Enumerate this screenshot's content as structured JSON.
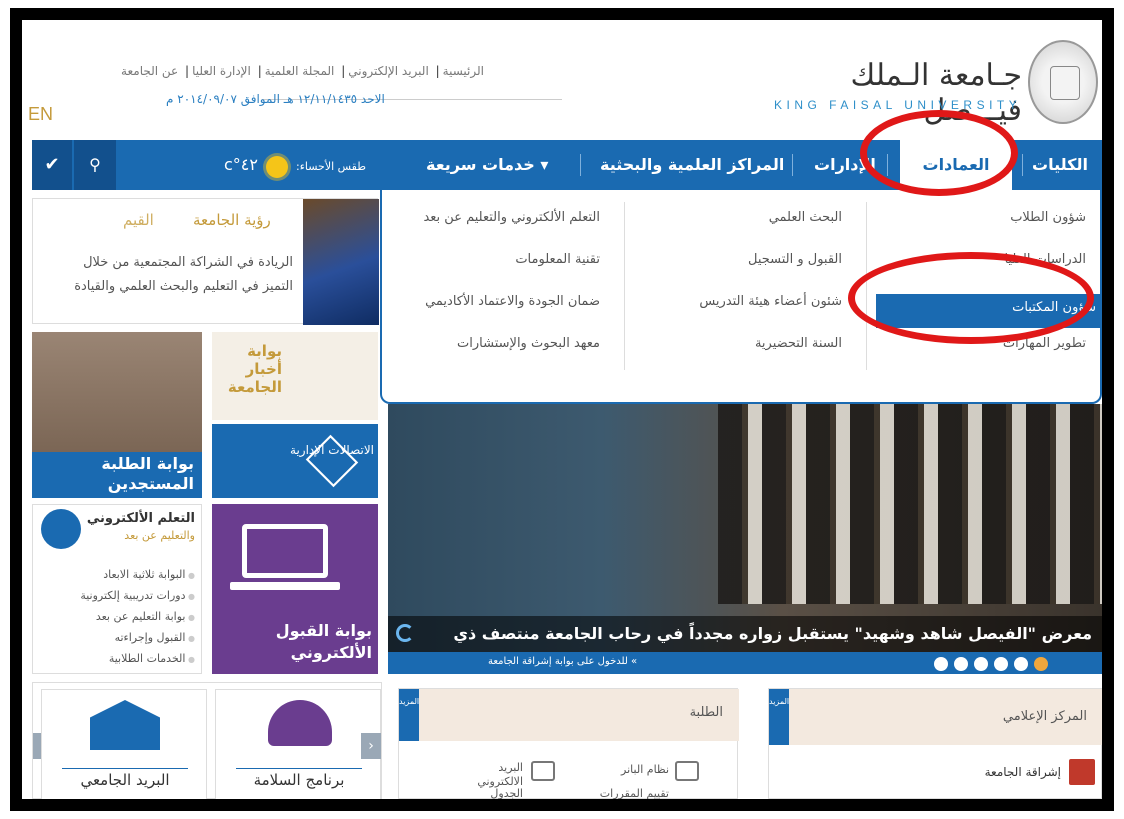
{
  "header": {
    "lang_switch": "EN",
    "top_links": [
      "الرئيسية",
      "البريد الإلكتروني",
      "المجلة العلمية",
      "الإدارة العليا",
      "عن الجامعة"
    ],
    "date_hijri": "الاحد ١٢/١١/١٤٣٥ هـ",
    "date_gregorian": "الموافق ٢٠١٤/٠٩/٠٧ م",
    "logo_arabic": "جـامعة الـملك فيـــصل",
    "logo_english": "KING FAISAL UNIVERSITY"
  },
  "nav": {
    "items": [
      "الكليات",
      "العمادات",
      "الإدارات",
      "المراكز العلمية والبحثية",
      "خدمات سريعة"
    ],
    "active": "العمادات",
    "weather_label": "طقس الأحساء:",
    "weather_temp": "٤٢°c",
    "search_icon": "search-icon",
    "check_icon": "check-icon"
  },
  "dropdown": {
    "col_right": [
      "شؤون الطلاب",
      "الدراسات العليا",
      "شؤون المكتبات",
      "تطوير المهارات"
    ],
    "col_middle": [
      "البحث العلمي",
      "القبول و التسجيل",
      "شئون أعضاء هيئة التدريس",
      "السنة التحضيرية"
    ],
    "col_left": [
      "التعلم الألكتروني والتعليم عن بعد",
      "تقنية المعلومات",
      "ضمان الجودة والاعتماد الأكاديمي",
      "معهد البحوث والإستشارات"
    ],
    "highlighted": "شؤون المكتبات"
  },
  "vision": {
    "tab_vision": "رؤية الجامعة",
    "tab_values": "القيم",
    "text": "الريادة في الشراكة المجتمعية من خلال التميز في التعليم والبحث العلمي والقيادة"
  },
  "tiles": {
    "students_portal": "بوابة الطلبة المستجدين",
    "news_portal": "بوابة أخبار الجامعة",
    "admin_comm": "الاتصالات الإدارية",
    "admission_portal": "بوابة القبول الألكتروني"
  },
  "elearning": {
    "title": "التعلم الألكتروني",
    "subtitle": "والتعليم عن بعد",
    "links": [
      "البوابة ثلاثية الابعاد",
      "دورات تدريبية إلكترونية",
      "بوابة التعليم عن بعد",
      "القبول وإجراءته",
      "الخدمات الطلابية"
    ]
  },
  "slider": {
    "caption": "معرض \"الفيصل شاهد وشهيد\" يستقبل زواره مجدداً في رحاب الجامعة منتصف ذي",
    "link": "» للدخول على بوابة إشراقة الجامعة",
    "dots": 6,
    "active_dot": 5
  },
  "bottom": {
    "mail": "البريد الجامعي",
    "safety": "برنامج السلامة",
    "students_title": "الطلبة",
    "more_label": "المزيد",
    "student_links": [
      "نظام البانر",
      "البريد الالكتروني",
      "تقييم المقررات",
      "الجدول"
    ],
    "media_title": "المركز الإعلامي",
    "media_link": "إشراقة الجامعة"
  }
}
